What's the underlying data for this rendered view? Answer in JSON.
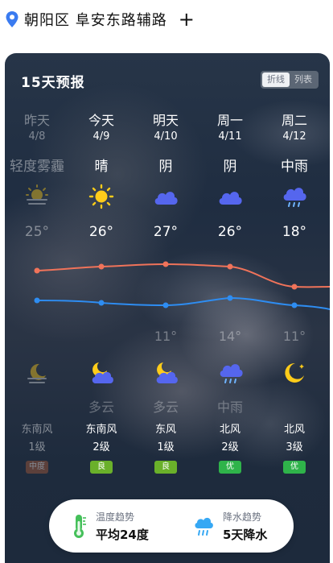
{
  "location": {
    "text": "朝阳区 阜安东路辅路",
    "add_symbol": "+"
  },
  "forecast": {
    "title": "15天预报",
    "view_toggle": [
      "折线",
      "列表"
    ],
    "days": [
      {
        "day": "昨天",
        "date": "4/8",
        "condition": "轻度雾霾",
        "high": "25°",
        "low": "",
        "day_icon": "haze-icon",
        "night_icon": "moon-haze-icon",
        "night_condition": "",
        "wind_dir": "东南风",
        "wind_level": "1级",
        "aqi": "中度",
        "aqi_color": "#a85a3a",
        "past": true
      },
      {
        "day": "今天",
        "date": "4/9",
        "condition": "晴",
        "high": "26°",
        "low": "",
        "day_icon": "sun-icon",
        "night_icon": "moon-cloud-icon",
        "night_condition": "多云",
        "wind_dir": "东南风",
        "wind_level": "2级",
        "aqi": "良",
        "aqi_color": "#6ab02a",
        "past": false
      },
      {
        "day": "明天",
        "date": "4/10",
        "condition": "阴",
        "high": "27°",
        "low": "11°",
        "day_icon": "cloud-icon",
        "night_icon": "moon-cloud-icon",
        "night_condition": "多云",
        "wind_dir": "东风",
        "wind_level": "1级",
        "aqi": "良",
        "aqi_color": "#6ab02a",
        "past": false
      },
      {
        "day": "周一",
        "date": "4/11",
        "condition": "阴",
        "high": "26°",
        "low": "14°",
        "day_icon": "cloud-icon",
        "night_icon": "rain-cloud-icon",
        "night_condition": "中雨",
        "wind_dir": "北风",
        "wind_level": "2级",
        "aqi": "优",
        "aqi_color": "#2fb34a",
        "past": false
      },
      {
        "day": "周二",
        "date": "4/12",
        "condition": "中雨",
        "high": "18°",
        "low": "11°",
        "day_icon": "rain-cloud-icon",
        "night_icon": "moon-icon",
        "night_condition": "",
        "wind_dir": "北风",
        "wind_level": "3级",
        "aqi": "优",
        "aqi_color": "#2fb34a",
        "past": false
      }
    ]
  },
  "trends": [
    {
      "label": "温度趋势",
      "value": "平均24度",
      "icon": "thermometer-icon"
    },
    {
      "label": "降水趋势",
      "value": "5天降水",
      "icon": "rain-cloud-icon"
    }
  ]
}
